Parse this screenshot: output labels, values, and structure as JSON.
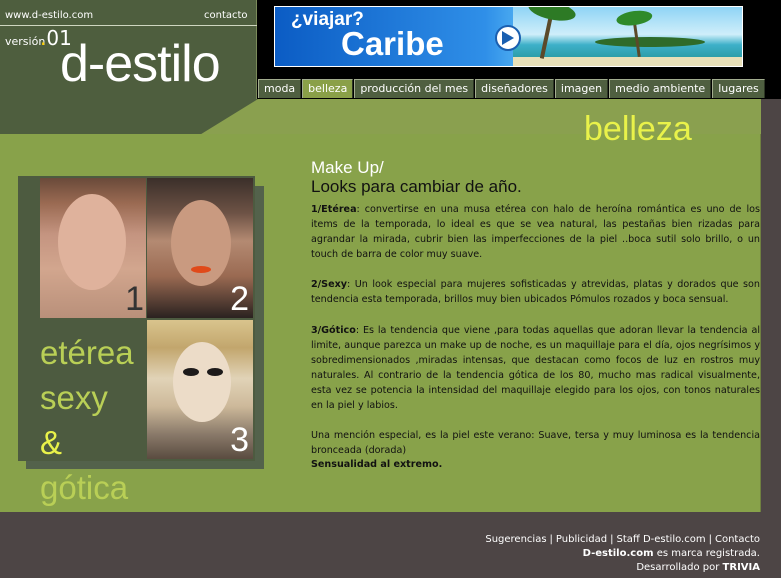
{
  "header": {
    "site_url": "www.d-estilo.com",
    "contact_link": "contacto",
    "version_label": "versión",
    "version_number": "01",
    "logo": "d-estilo"
  },
  "banner": {
    "question": "¿viajar?",
    "destination": "Caribe",
    "arrow_icon": "arrow-right-circle-icon"
  },
  "nav": {
    "tabs": [
      {
        "label": "moda",
        "active": false
      },
      {
        "label": "belleza",
        "active": true
      },
      {
        "label": "producción del mes",
        "active": false
      },
      {
        "label": "diseñadores",
        "active": false
      },
      {
        "label": "imagen",
        "active": false
      },
      {
        "label": "medio ambiente",
        "active": false
      },
      {
        "label": "lugares",
        "active": false
      }
    ]
  },
  "section": {
    "title": "belleza"
  },
  "photos": {
    "numbers": [
      "1",
      "2",
      "3"
    ],
    "tagline_line1": "etérea",
    "tagline_line2_word": "sexy",
    "tagline_line2_amp": "&",
    "tagline_line3": "gótica"
  },
  "article": {
    "heading": "Make Up/",
    "subheading": "Looks para cambiar de año.",
    "p1_label": "1/Etérea",
    "p1_text": ": convertirse en una musa etérea con halo de heroína romántica es uno de los items de la temporada, lo ideal es que se vea natural, las pestañas bien rizadas para agrandar la mirada, cubrir bien las imperfecciones de la piel ..boca sutil solo brillo, o un touch de barra de color muy suave.",
    "p2_label": "2/Sexy",
    "p2_text": ": Un look especial para mujeres sofisticadas y atrevidas, platas y dorados que son tendencia esta temporada, brillos muy bien ubicados Pómulos rozados y boca sensual.",
    "p3_label": "3/Gótico",
    "p3_text": ": Es la tendencia que viene ,para todas aquellas que adoran llevar la tendencia al limite, aunque parezca un make up de noche, es un maquillaje para el día, ojos negrísimos y sobredimensionados ,miradas intensas, que destacan como focos de luz en rostros muy naturales. Al contrario de la tendencia gótica de los 80, mucho mas radical visualmente, esta vez se potencia la intensidad del maquillaje elegido para los ojos, con tonos naturales en la piel y labios.",
    "p4_text": "Una mención especial, es la piel este verano: Suave, tersa y muy luminosa es la tendencia bronceada (dorada)",
    "closing": "Sensualidad al extremo."
  },
  "footer": {
    "links": [
      "Sugerencias",
      "Publicidad",
      "Staff D-estilo.com",
      "Contacto"
    ],
    "separator": "|",
    "brand": "D-estilo.com",
    "brand_text": "es marca registrada.",
    "developed_by": "Desarrollado por",
    "developer": "TRIVIA"
  },
  "colors": {
    "green_main": "#88a24a",
    "green_dark": "#4e5e3e",
    "accent_yellow": "#e9f24a",
    "footer_bg": "#4d4545"
  }
}
